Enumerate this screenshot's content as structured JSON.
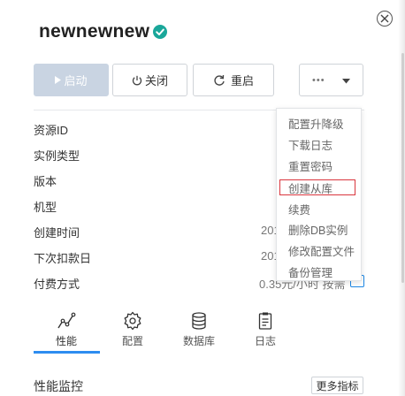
{
  "header": {
    "title": "newnewnew"
  },
  "actions": {
    "start": "启动",
    "stop": "关闭",
    "restart": "重启",
    "more": "•••"
  },
  "details": [
    {
      "label": "资源ID",
      "value": ""
    },
    {
      "label": "实例类型",
      "value": ""
    },
    {
      "label": "版本",
      "value": ""
    },
    {
      "label": "机型",
      "value": ""
    },
    {
      "label": "创建时间",
      "value": "201"
    },
    {
      "label": "下次扣款日",
      "value": "201"
    },
    {
      "label": "付费方式",
      "value": "0.35元/小时 按需"
    }
  ],
  "more_menu": {
    "items": [
      "配置升降级",
      "下载日志",
      "重置密码",
      "创建从库",
      "续费",
      "删除DB实例",
      "修改配置文件",
      "备份管理"
    ],
    "highlighted": "创建从库"
  },
  "tabs": [
    {
      "label": "性能",
      "icon": "line-chart-icon",
      "active": true
    },
    {
      "label": "配置",
      "icon": "gear-icon",
      "active": false
    },
    {
      "label": "数据库",
      "icon": "database-icon",
      "active": false
    },
    {
      "label": "日志",
      "icon": "document-icon",
      "active": false
    }
  ],
  "monitor": {
    "title": "性能监控",
    "more_button": "更多指标"
  },
  "colors": {
    "accent": "#2d8cf0",
    "status_ok": "#1aa79a",
    "start_disabled": "#c9d4e2",
    "highlight": "#d9363e"
  }
}
